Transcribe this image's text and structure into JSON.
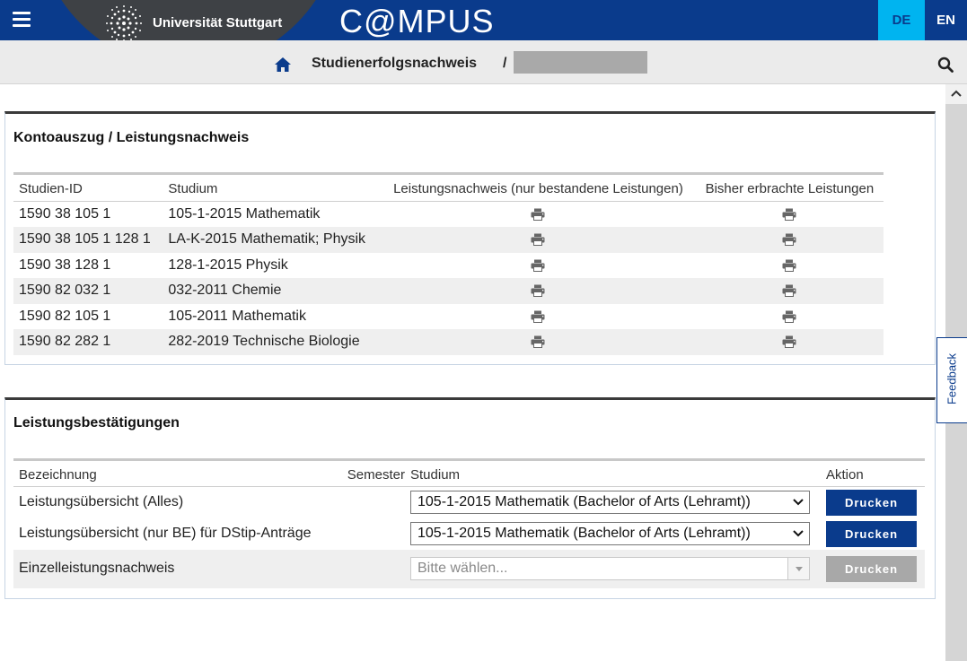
{
  "header": {
    "university": "Universität Stuttgart",
    "app_title": "C@MPUS",
    "lang_de": "DE",
    "lang_en": "EN"
  },
  "breadcrumb": {
    "current": "Studienerfolgsnachweis",
    "separator": "/"
  },
  "feedback_label": "Feedback",
  "konto": {
    "title": "Kontoauszug / Leistungsnachweis",
    "columns": [
      "Studien-ID",
      "Studium",
      "Leistungsnachweis (nur bestandene Leistungen)",
      "Bisher erbrachte Leistungen"
    ],
    "rows": [
      {
        "id": "1590 38 105 1",
        "studium": "105-1-2015 Mathematik"
      },
      {
        "id": "1590 38 105 1 128 1",
        "studium": "LA-K-2015 Mathematik; Physik"
      },
      {
        "id": "1590 38 128 1",
        "studium": "128-1-2015 Physik"
      },
      {
        "id": "1590 82 032 1",
        "studium": "032-2011 Chemie"
      },
      {
        "id": "1590 82 105 1",
        "studium": "105-2011 Mathematik"
      },
      {
        "id": "1590 82 282 1",
        "studium": "282-2019 Technische Biologie"
      }
    ]
  },
  "bestaetigungen": {
    "title": "Leistungsbestätigungen",
    "columns": [
      "Bezeichnung",
      "Semester",
      "Studium",
      "Aktion"
    ],
    "rows": [
      {
        "bezeichnung": "Leistungsübersicht (Alles)",
        "studium": "105-1-2015 Mathematik (Bachelor of Arts (Lehramt))",
        "action": "Drucken"
      },
      {
        "bezeichnung": "Leistungsübersicht (nur BE) für DStip-Anträge",
        "studium": "105-1-2015 Mathematik (Bachelor of Arts (Lehramt))",
        "action": "Drucken"
      },
      {
        "bezeichnung": "Einzelleistungsnachweis",
        "placeholder": "Bitte wählen...",
        "action": "Drucken"
      }
    ]
  },
  "colors": {
    "brand_blue": "#0a3b8c",
    "lang_active": "#00b4f0",
    "disabled": "#a8a8a8"
  }
}
